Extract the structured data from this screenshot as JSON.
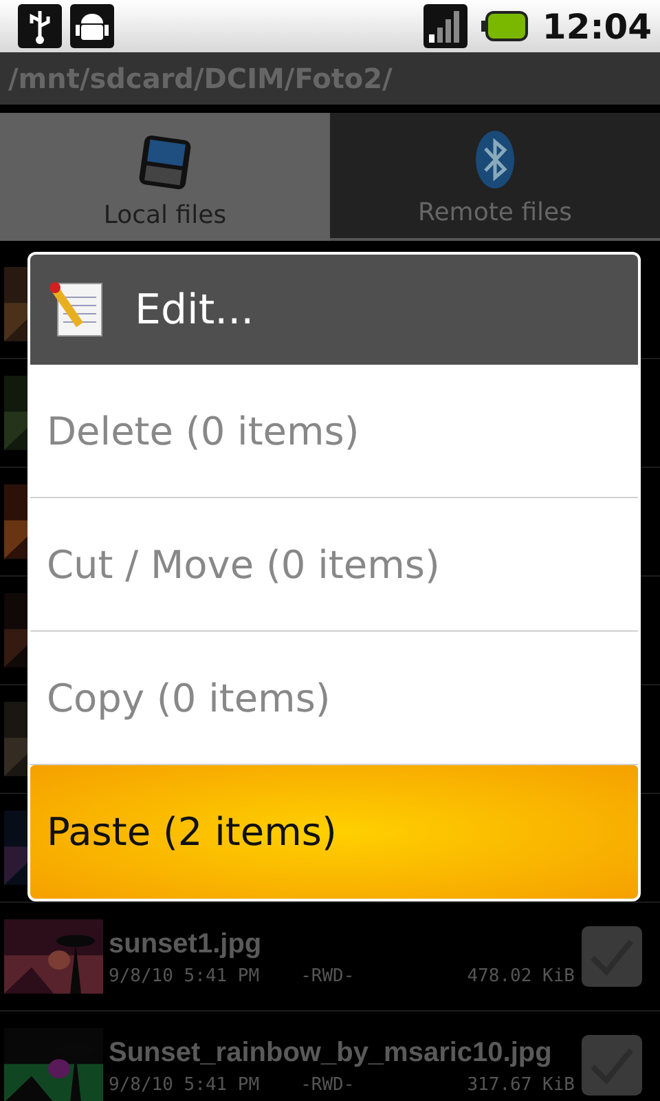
{
  "status_bar": {
    "time": "12:04"
  },
  "path": "/mnt/sdcard/DCIM/Foto2/",
  "tabs": [
    {
      "label": "Local files",
      "selected": true
    },
    {
      "label": "Remote files",
      "selected": false
    }
  ],
  "files": [
    {
      "kind": "covered"
    },
    {
      "kind": "covered"
    },
    {
      "kind": "covered"
    },
    {
      "kind": "covered"
    },
    {
      "kind": "covered"
    },
    {
      "kind": "covered"
    },
    {
      "kind": "file",
      "name": "sunset1.jpg",
      "date": "9/8/10 5:41 PM",
      "permissions": "-RWD-",
      "size": "478.02 KiB",
      "checked": false
    },
    {
      "kind": "file",
      "name": "Sunset_rainbow_by_msaric10.jpg",
      "date": "9/8/10 5:41 PM",
      "permissions": "-RWD-",
      "size": "317.67 KiB",
      "checked": false
    }
  ],
  "dialog": {
    "title": "Edit...",
    "items": [
      {
        "label": "Delete (0 items)",
        "disabled": true,
        "selected": false
      },
      {
        "label": "Cut / Move (0 items)",
        "disabled": true,
        "selected": false
      },
      {
        "label": "Copy (0 items)",
        "disabled": true,
        "selected": false
      },
      {
        "label": "Paste (2 items)",
        "disabled": false,
        "selected": true
      }
    ]
  }
}
